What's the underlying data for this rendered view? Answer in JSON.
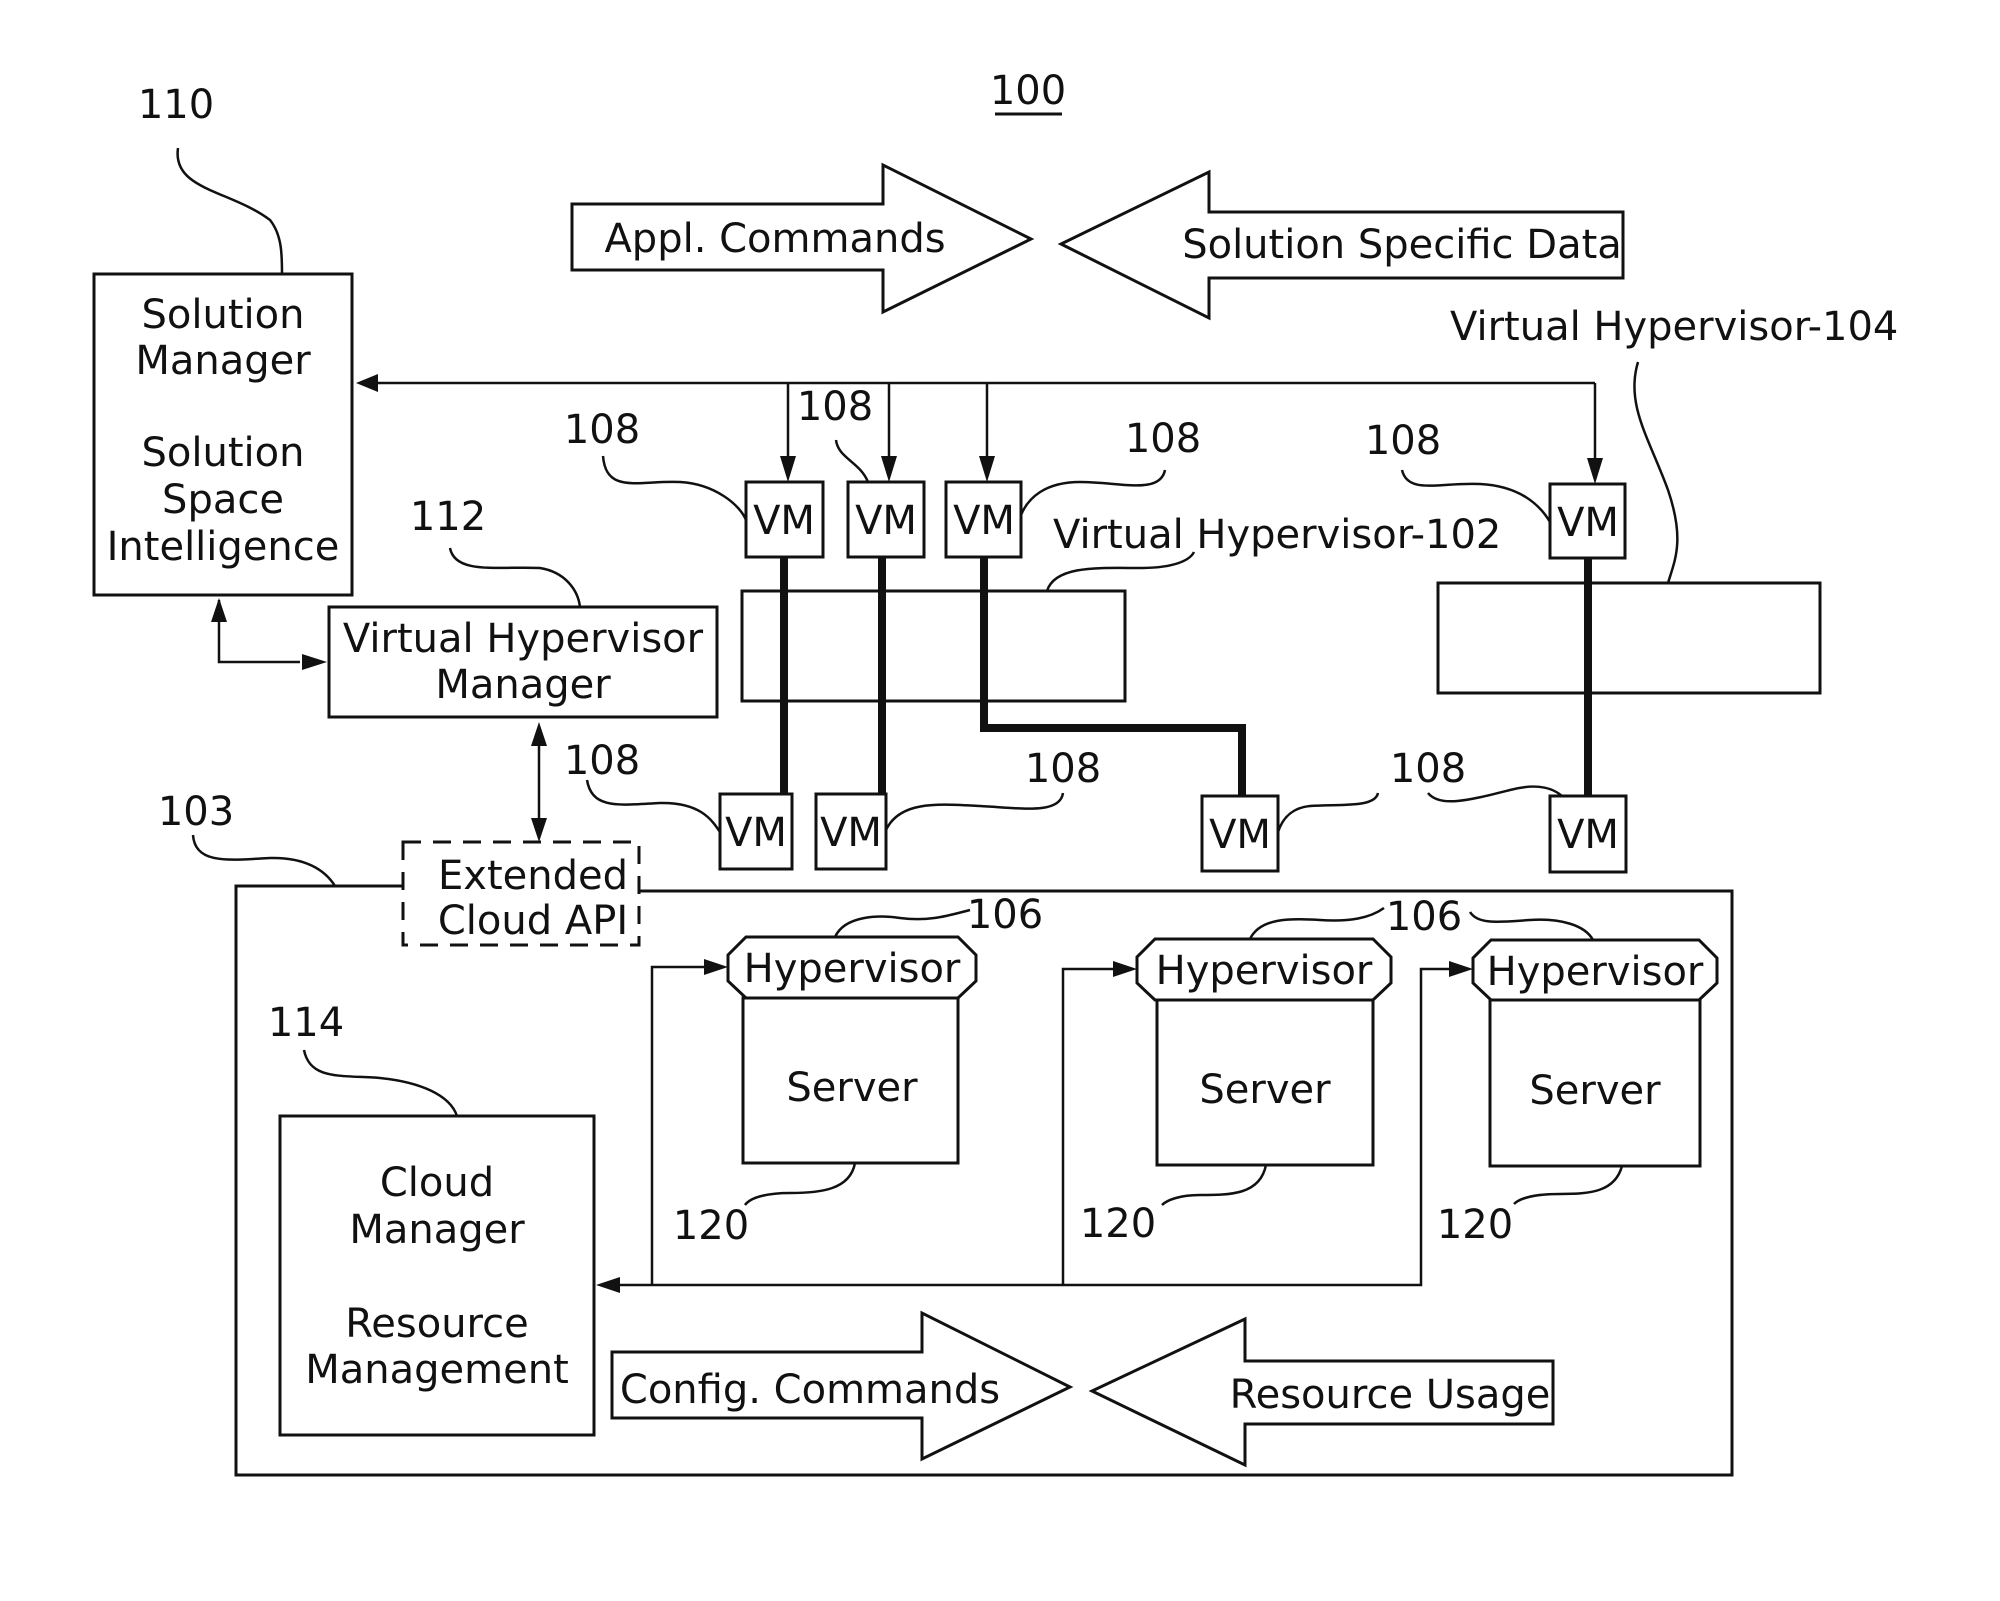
{
  "figure": {
    "number": "100"
  },
  "top_arrows": {
    "commands": "Appl. Commands",
    "data": "Solution Specific Data"
  },
  "solution_manager": {
    "ref": "110",
    "line1": "Solution",
    "line2": "Manager",
    "line3": "Solution",
    "line4": "Space",
    "line5": "Intelligence"
  },
  "vh_manager": {
    "ref": "112",
    "line1": "Virtual Hypervisor",
    "line2": "Manager"
  },
  "virtual_hypervisors": [
    {
      "label": "Virtual Hypervisor-102"
    },
    {
      "label": "Virtual Hypervisor-104"
    }
  ],
  "vm": {
    "label": "VM",
    "ref": "108"
  },
  "cloud": {
    "ref": "103",
    "api_line1": "Extended",
    "api_line2": "Cloud API"
  },
  "cloud_manager": {
    "ref": "114",
    "line1": "Cloud",
    "line2": "Manager",
    "line3": "Resource",
    "line4": "Management"
  },
  "hosts": [
    {
      "hypervisor": "Hypervisor",
      "server": "Server",
      "hyp_ref": "106",
      "server_ref": "120"
    },
    {
      "hypervisor": "Hypervisor",
      "server": "Server",
      "hyp_ref": "106",
      "server_ref": "120"
    },
    {
      "hypervisor": "Hypervisor",
      "server": "Server",
      "hyp_ref": "",
      "server_ref": "120"
    }
  ],
  "bottom_arrows": {
    "commands": "Config. Commands",
    "usage": "Resource Usage"
  }
}
